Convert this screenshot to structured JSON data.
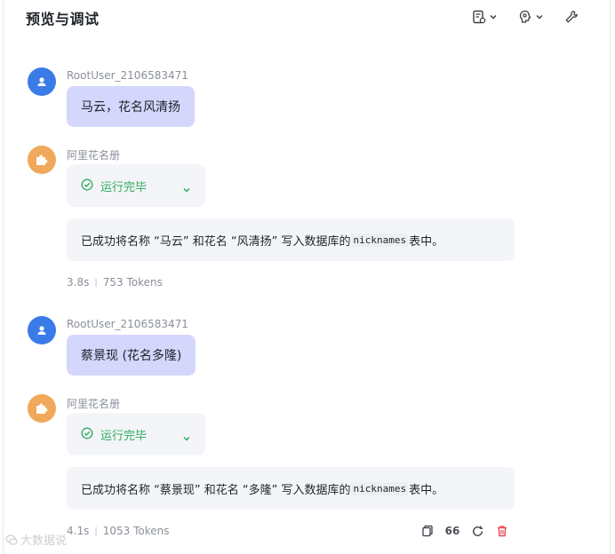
{
  "header": {
    "title": "预览与调试",
    "icons": [
      "document-settings-icon",
      "chevron-down-icon",
      "brain-icon",
      "chevron-down-icon",
      "wrench-icon"
    ]
  },
  "conversation": [
    {
      "user_name": "RootUser_2106583471",
      "user_text": "马云，花名风清扬",
      "bot_name": "阿里花名册",
      "status": "运行完毕",
      "answer_prefix": "已成功将名称 “马云” 和花名 “风清扬” 写入数据库的",
      "answer_code": "nicknames",
      "answer_suffix": "表中。",
      "time": "3.8s",
      "tokens": "753 Tokens"
    },
    {
      "user_name": "RootUser_2106583471",
      "user_text": "蔡景现 (花名多隆)",
      "bot_name": "阿里花名册",
      "status": "运行完毕",
      "answer_prefix": "已成功将名称 “蔡景现” 和花名 “多隆” 写入数据库的",
      "answer_code": "nicknames",
      "answer_suffix": "表中。",
      "time": "4.1s",
      "tokens": "1053 Tokens"
    }
  ],
  "actions": {
    "quote_label": "66"
  },
  "colors": {
    "user_avatar": "#3a7be8",
    "bot_avatar": "#f0a85a",
    "user_bubble": "#d4d6fb",
    "status_green": "#2eac5f",
    "delete_red": "#e5484d"
  },
  "watermark": "大数据说"
}
